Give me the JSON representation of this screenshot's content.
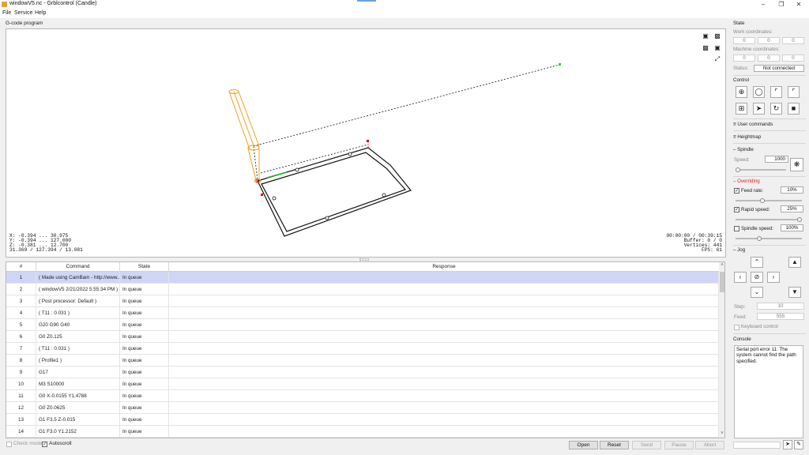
{
  "window": {
    "title": "windowV5.nc - Grblcontrol  (Candle)"
  },
  "menu": [
    "File",
    "Service",
    "Help"
  ],
  "viewport": {
    "title": "G-code program",
    "coords": {
      "x": "X: -0.394 ... 30.975",
      "y": "Y: -0.394 ... 127.000",
      "z": "Z: -0.381 ... 12.700",
      "dims": "31.369 / 127.394 / 13.081"
    },
    "stats": {
      "time": "00:00:00 / 00:39:15",
      "buffer": "Buffer: 0 / 0",
      "vertices": "Vertices: 441",
      "fps": "FPS: 61"
    }
  },
  "table": {
    "headers": [
      "#",
      "Command",
      "State",
      "Response"
    ],
    "rows": [
      {
        "n": "1",
        "cmd": "( Made using CamBam - http://www....",
        "state": "In queue",
        "resp": ""
      },
      {
        "n": "2",
        "cmd": "( windowV5 2/21/2022 5:55:34 PM )",
        "state": "In queue",
        "resp": ""
      },
      {
        "n": "3",
        "cmd": "( Post processor: Default )",
        "state": "In queue",
        "resp": ""
      },
      {
        "n": "4",
        "cmd": "( T11 : 0.031 )",
        "state": "In queue",
        "resp": ""
      },
      {
        "n": "5",
        "cmd": "G20 G90 G40",
        "state": "In queue",
        "resp": ""
      },
      {
        "n": "6",
        "cmd": "G0 Z0.125",
        "state": "In queue",
        "resp": ""
      },
      {
        "n": "7",
        "cmd": "( T11 : 0.031 )",
        "state": "In queue",
        "resp": ""
      },
      {
        "n": "8",
        "cmd": "( Profile1 )",
        "state": "In queue",
        "resp": ""
      },
      {
        "n": "9",
        "cmd": "G17",
        "state": "In queue",
        "resp": ""
      },
      {
        "n": "10",
        "cmd": "M3 S10000",
        "state": "In queue",
        "resp": ""
      },
      {
        "n": "11",
        "cmd": "G0 X-0.0155 Y1.4788",
        "state": "In queue",
        "resp": ""
      },
      {
        "n": "12",
        "cmd": "G0 Z0.0625",
        "state": "In queue",
        "resp": ""
      },
      {
        "n": "13",
        "cmd": "G1 F3.5 Z-0.015",
        "state": "In queue",
        "resp": ""
      },
      {
        "n": "14",
        "cmd": "G1 F3.0 Y1.2152",
        "state": "In queue",
        "resp": ""
      }
    ]
  },
  "bottom": {
    "check_mode": "Check mode",
    "autoscroll": "Autoscroll",
    "buttons": [
      "Open",
      "Reset",
      "Send",
      "Pause",
      "Abort"
    ]
  },
  "panel": {
    "state": {
      "title": "State",
      "work_label": "Work coordinates:",
      "work": [
        "0",
        "0",
        "0"
      ],
      "machine_label": "Machine coordinates:",
      "machine": [
        "0",
        "0",
        "0"
      ],
      "status_label": "Status:",
      "status": "Not connected"
    },
    "control": {
      "title": "Control"
    },
    "user_commands": "User commands",
    "heightmap": "Heightmap",
    "spindle": {
      "title": "Spindle",
      "speed_label": "Speed:",
      "speed": "1000",
      "slider_level": 0.0
    },
    "overriding": {
      "title": "Overriding",
      "feed_label": "Feed rate:",
      "feed": "10%",
      "feed_level": 0.4,
      "rapid_label": "Rapid speed:",
      "rapid": "25%",
      "rapid_level": 1.0,
      "spindle_label": "Spindle speed:",
      "spindle": "100%",
      "spindle_level": 0.35
    },
    "jog": {
      "title": "Jog",
      "step_label": "Step:",
      "step": "10",
      "feed_label": "Feed:",
      "feed": "555",
      "keyboard": "Keyboard control"
    },
    "console": {
      "title": "Console",
      "text": "Serial port error 11: The system cannot find the path specified."
    }
  },
  "colors": {
    "tool": "#f0a020",
    "selection": "#cfd6f5",
    "overriding": "#dd2222"
  }
}
